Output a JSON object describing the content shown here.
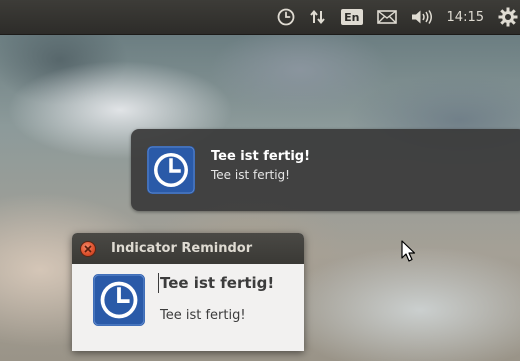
{
  "top_panel": {
    "indicators": [
      {
        "icon": "clock-icon"
      },
      {
        "icon": "network-arrows-icon"
      },
      {
        "icon": "keyboard-layout-icon",
        "label": "En"
      },
      {
        "icon": "mail-envelope-icon"
      },
      {
        "icon": "volume-icon"
      },
      {
        "icon": "session-gear-icon"
      }
    ],
    "clock": "14:15",
    "keyboard_layout": "En"
  },
  "notification": {
    "icon": "reminder-clock-icon",
    "title": "Tee ist fertig!",
    "body": "Tee ist fertig!"
  },
  "dialog": {
    "window_title": "Indicator Remindor",
    "icon": "reminder-clock-icon",
    "heading": "Tee ist fertig!",
    "body": "Tee ist fertig!",
    "close_icon": "close-icon"
  },
  "colors": {
    "panel": "#3a3935",
    "panel_text": "#dfdbd2",
    "close_button": "#e0532f",
    "clock_icon_blue": "#2a5aa8",
    "notification_bg": "#3a3a3a",
    "dialog_bg": "#f2f1f0"
  }
}
